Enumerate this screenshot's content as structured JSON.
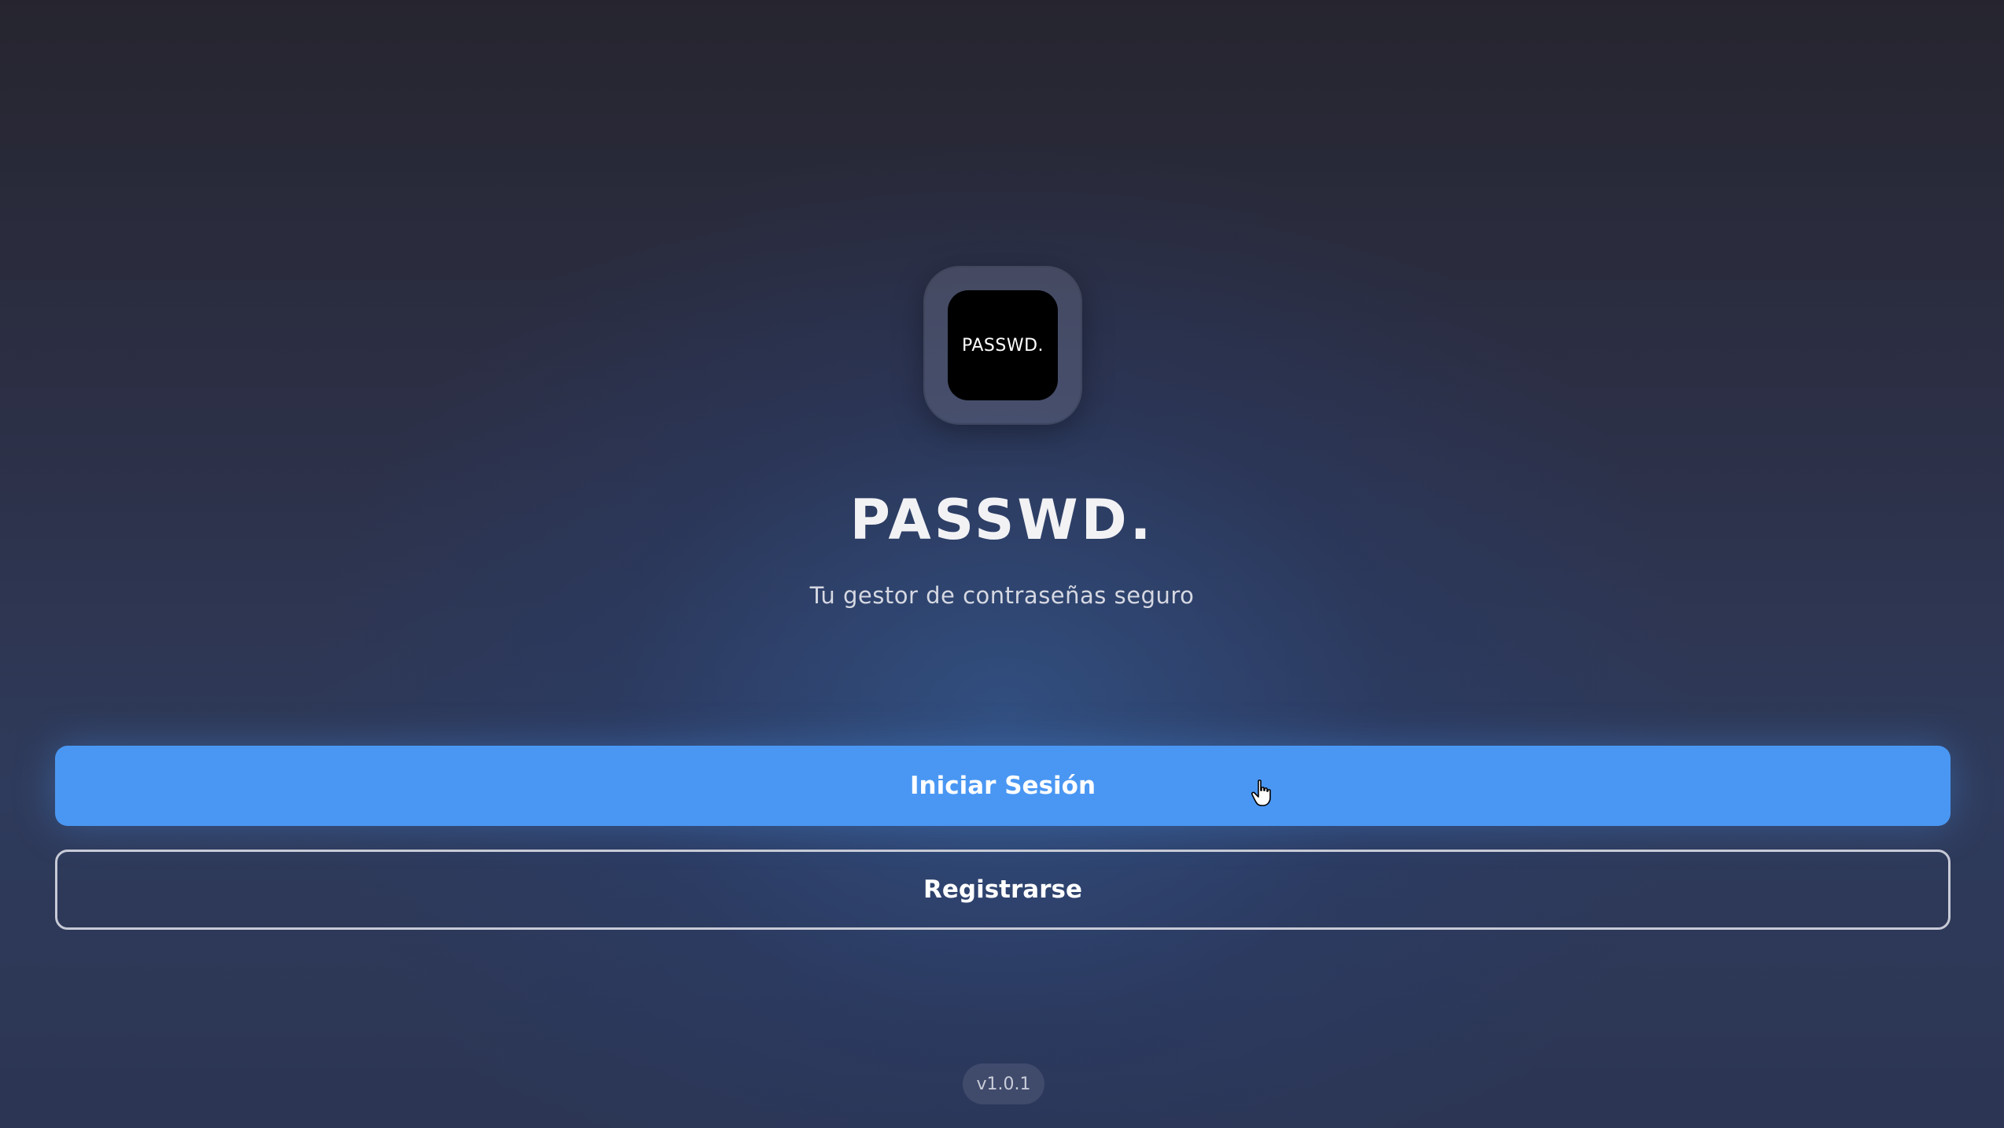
{
  "app": {
    "logo_text": "PASSWD.",
    "title": "PASSWD.",
    "subtitle": "Tu gestor de contraseñas seguro",
    "version": "v1.0.1"
  },
  "actions": {
    "login_label": "Iniciar Sesión",
    "register_label": "Registrarse"
  },
  "colors": {
    "primary": "#4a97f3",
    "background_top": "#26252f",
    "background_bottom": "#2f3b5c",
    "logo_tile": "#000000"
  },
  "icons": {
    "cursor": "hand-pointer-icon"
  }
}
